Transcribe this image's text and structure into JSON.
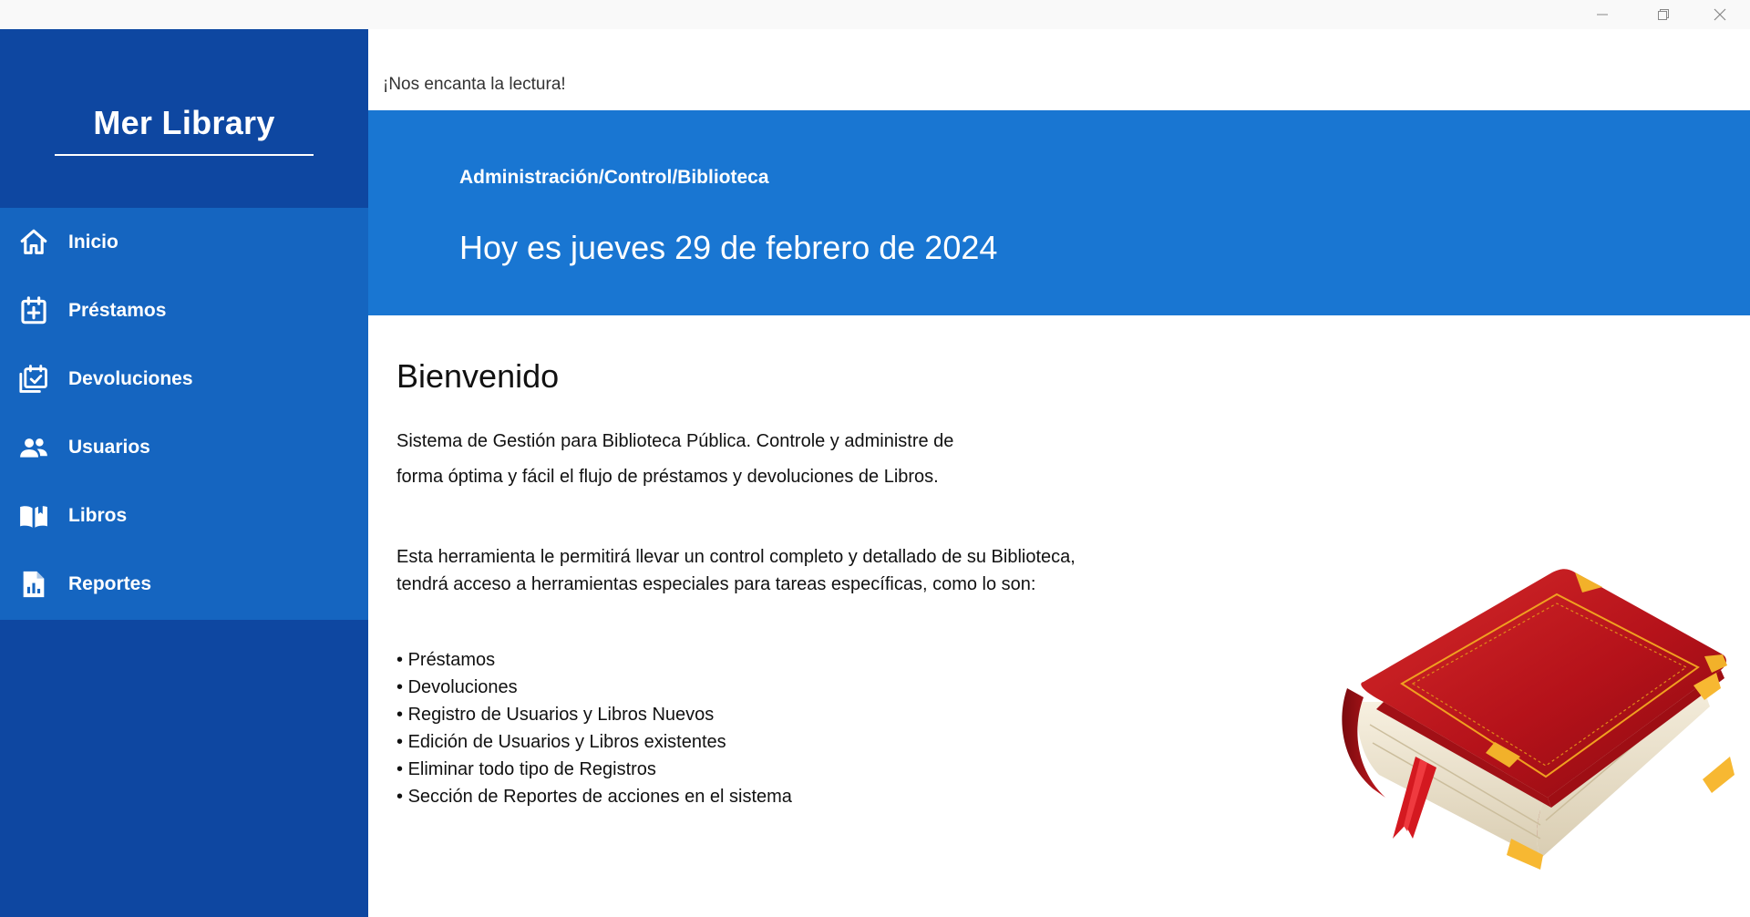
{
  "window": {
    "minimize_icon": "minimize-icon",
    "maximize_icon": "restore-icon",
    "close_icon": "close-icon"
  },
  "sidebar": {
    "brand": "Mer Library",
    "items": [
      {
        "label": "Inicio",
        "icon": "home-icon"
      },
      {
        "label": "Préstamos",
        "icon": "calendar-add-icon"
      },
      {
        "label": "Devoluciones",
        "icon": "calendar-check-icon"
      },
      {
        "label": "Usuarios",
        "icon": "users-icon"
      },
      {
        "label": "Libros",
        "icon": "open-book-icon"
      },
      {
        "label": "Reportes",
        "icon": "report-icon"
      }
    ]
  },
  "header": {
    "tagline": "¡Nos encanta la lectura!",
    "breadcrumb": "Administración/Control/Biblioteca",
    "date": "Hoy es jueves 29 de febrero de 2024"
  },
  "main": {
    "title": "Bienvenido",
    "intro_line1": "Sistema de Gestión para Biblioteca Pública. Controle y administre de",
    "intro_line2": "forma óptima y fácil el flujo de préstamos y devoluciones de Libros.",
    "desc_line1": "Esta herramienta le permitirá llevar un control completo y detallado de su Biblioteca,",
    "desc_line2": "tendrá acceso a herramientas especiales para tareas específicas, como lo son:",
    "features": [
      "Préstamos",
      "Devoluciones",
      "Registro de Usuarios y Libros Nuevos",
      "Edición de Usuarios y Libros existentes",
      "Eliminar todo tipo de Registros",
      "Sección de Reportes de acciones en el sistema"
    ],
    "illustration": "red-book-illustration"
  },
  "colors": {
    "sidebar_dark": "#0e47a1",
    "sidebar_nav": "#1565c0",
    "banner": "#1976d2",
    "book_red": "#c0161c",
    "book_gold": "#f0a020"
  }
}
